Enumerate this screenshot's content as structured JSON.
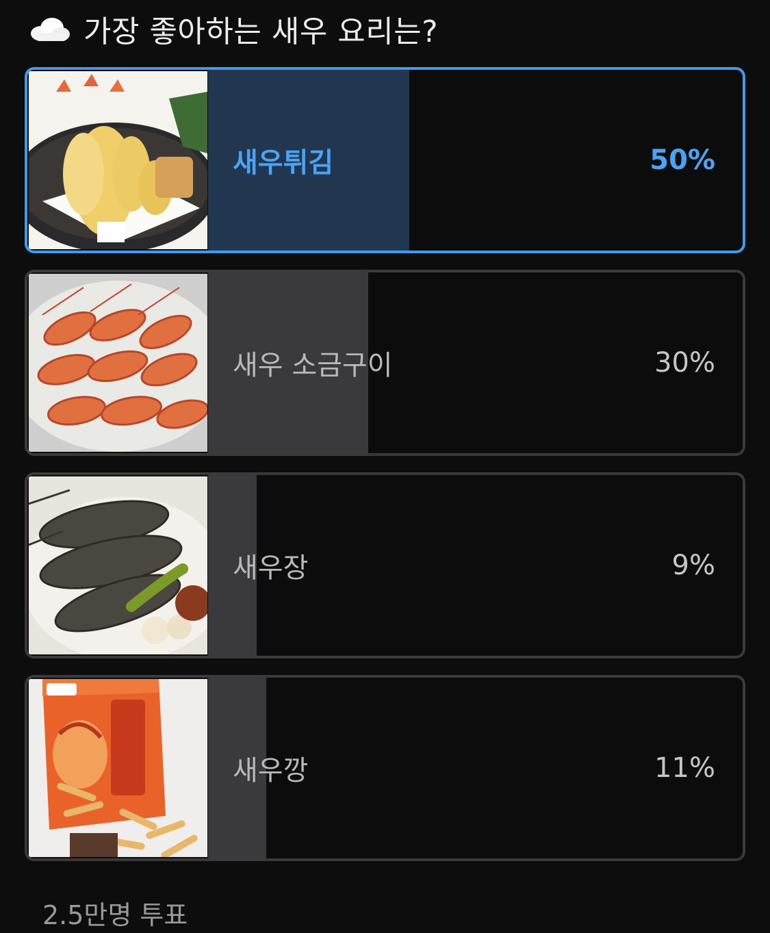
{
  "poll": {
    "icon": "cloud-icon",
    "title": "가장 좋아하는 새우 요리는?",
    "accent_color": "#3d9bf0",
    "options": [
      {
        "label": "새우튀김",
        "percent_text": "50%",
        "percent": 50,
        "image": "shrimp-tempura-image",
        "selected": true
      },
      {
        "label": "새우 소금구이",
        "percent_text": "30%",
        "percent": 30,
        "image": "salt-grilled-shrimp-image",
        "selected": false
      },
      {
        "label": "새우장",
        "percent_text": "9%",
        "percent": 9,
        "image": "soy-marinated-shrimp-image",
        "selected": false
      },
      {
        "label": "새우깡",
        "percent_text": "11%",
        "percent": 11,
        "image": "shrimp-cracker-snack-image",
        "selected": false
      }
    ],
    "vote_count": "2.5만명 투표"
  }
}
